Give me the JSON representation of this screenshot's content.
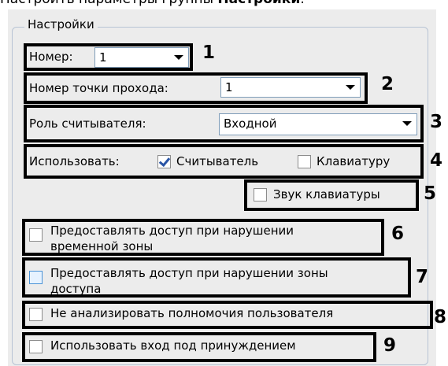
{
  "caption": {
    "prefix": "Настроить параметры группы ",
    "bold": "Настройки",
    "suffix": ":"
  },
  "group": {
    "title": "Настройки"
  },
  "fields": {
    "number": {
      "label": "Номер:",
      "value": "1",
      "marker": "1"
    },
    "pass_point": {
      "label": "Номер точки прохода:",
      "value": "1",
      "marker": "2"
    },
    "reader_role": {
      "label": "Роль считывателя:",
      "value": "Входной",
      "marker": "3"
    },
    "use": {
      "label": "Использовать:",
      "reader": "Считыватель",
      "keyboard": "Клавиатуру",
      "reader_checked": true,
      "keyboard_checked": false,
      "marker": "4"
    },
    "keyboard_sound": {
      "label": "Звук клавиатуры",
      "checked": false,
      "marker": "5"
    },
    "time_zone": {
      "line1": "Предоставлять доступ при нарушении",
      "line2": "временной зоны",
      "checked": false,
      "marker": "6"
    },
    "access_zone": {
      "line1": "Предоставлять доступ при нарушении зоны",
      "line2": "доступа",
      "checked": false,
      "marker": "7"
    },
    "no_analyze": {
      "label": "Не анализировать полномочия пользователя",
      "checked": false,
      "marker": "8"
    },
    "duress": {
      "label": "Использовать вход под принуждением",
      "checked": false,
      "marker": "9"
    }
  }
}
